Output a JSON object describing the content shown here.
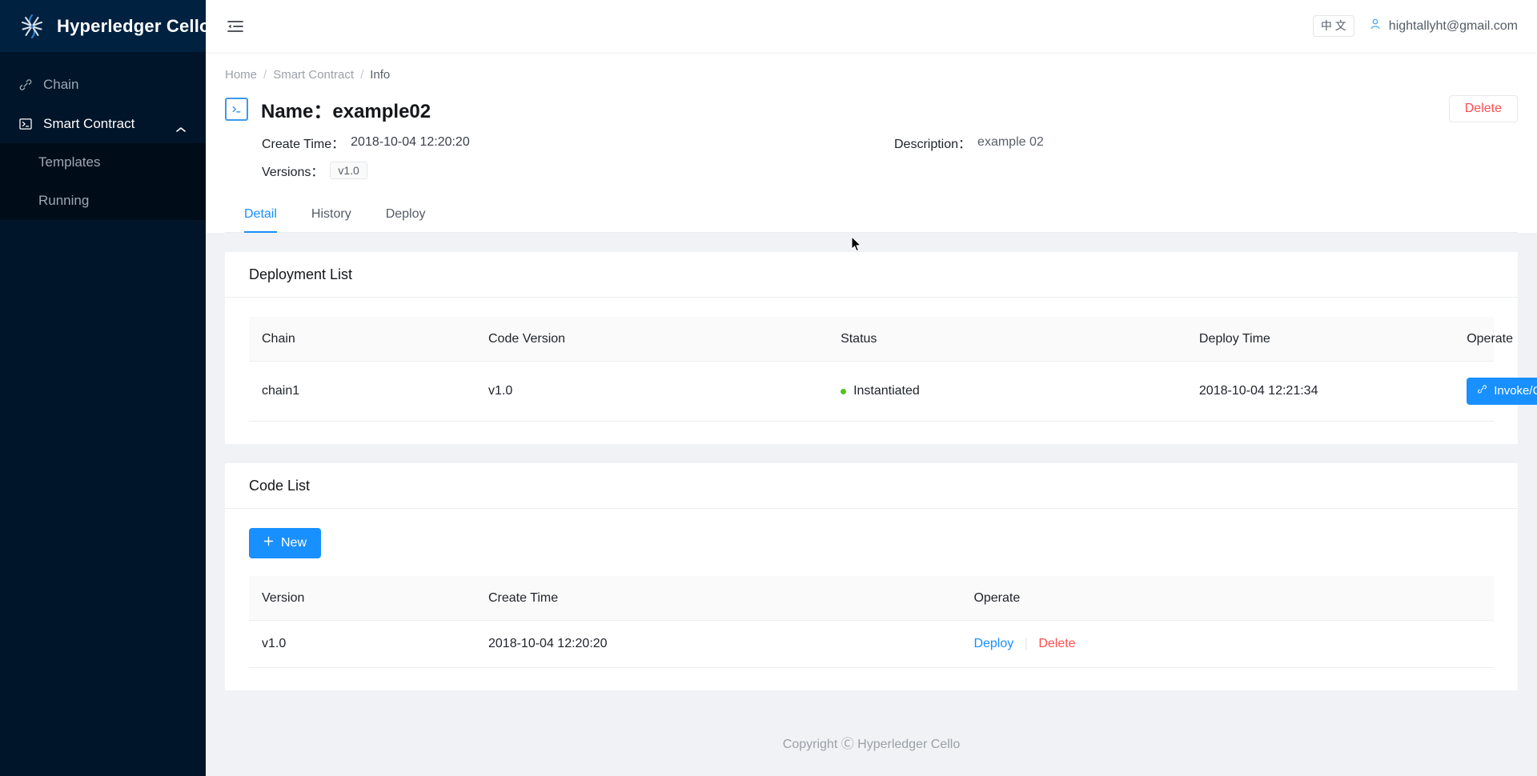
{
  "brand": {
    "name": "Hyperledger Cello",
    "logo_icon": "cello-pinwheel-logo-icon"
  },
  "sidebar": {
    "items": [
      {
        "label": "Chain",
        "icon": "link-icon",
        "expandable": false
      },
      {
        "label": "Smart Contract",
        "icon": "console-icon",
        "expandable": true,
        "caret": "chevron-up-icon"
      }
    ],
    "submenu": [
      {
        "label": "Templates"
      },
      {
        "label": "Running"
      }
    ]
  },
  "topbar": {
    "fold_icon": "menu-fold-icon",
    "lang_label": "中 文",
    "user_icon": "user-icon",
    "user_email": "hightallyht@gmail.com"
  },
  "breadcrumb": {
    "items": [
      "Home",
      "Smart Contract",
      "Info"
    ],
    "separator": "/"
  },
  "page": {
    "icon": "console-contract-icon",
    "title_label": "Name：",
    "title_value": "example02",
    "delete_label": "Delete",
    "create_time_label": "Create Time：",
    "create_time_value": "2018-10-04 12:20:20",
    "versions_label": "Versions：",
    "versions_value": "v1.0",
    "description_label": "Description：",
    "description_value": "example 02"
  },
  "tabs": [
    {
      "label": "Detail",
      "active": true
    },
    {
      "label": "History",
      "active": false
    },
    {
      "label": "Deploy",
      "active": false
    }
  ],
  "deployment_list": {
    "title": "Deployment List",
    "columns": [
      "Chain",
      "Code Version",
      "Status",
      "Deploy Time",
      "Operate"
    ],
    "rows": [
      {
        "chain": "chain1",
        "code_version": "v1.0",
        "status": "Instantiated",
        "status_color": "#52c41a",
        "deploy_time": "2018-10-04 12:21:34",
        "operate_label": "Invoke/Query",
        "operate_icon": "link-chain-icon"
      }
    ]
  },
  "code_list": {
    "title": "Code List",
    "new_label": "New",
    "new_icon": "plus-icon",
    "columns": [
      "Version",
      "Create Time",
      "Operate"
    ],
    "rows": [
      {
        "version": "v1.0",
        "create_time": "2018-10-04 12:20:20",
        "deploy_label": "Deploy",
        "delete_label": "Delete"
      }
    ]
  },
  "footer": {
    "copyright": "Copyright Ⓒ Hyperledger Cello"
  },
  "colors": {
    "primary": "#1890ff",
    "danger": "#ff4d4f",
    "success": "#52c41a",
    "sidebar_bg": "#001529",
    "sidebar_logo_bg": "#002140",
    "submenu_bg": "#000c17",
    "page_bg": "#f0f2f5"
  }
}
